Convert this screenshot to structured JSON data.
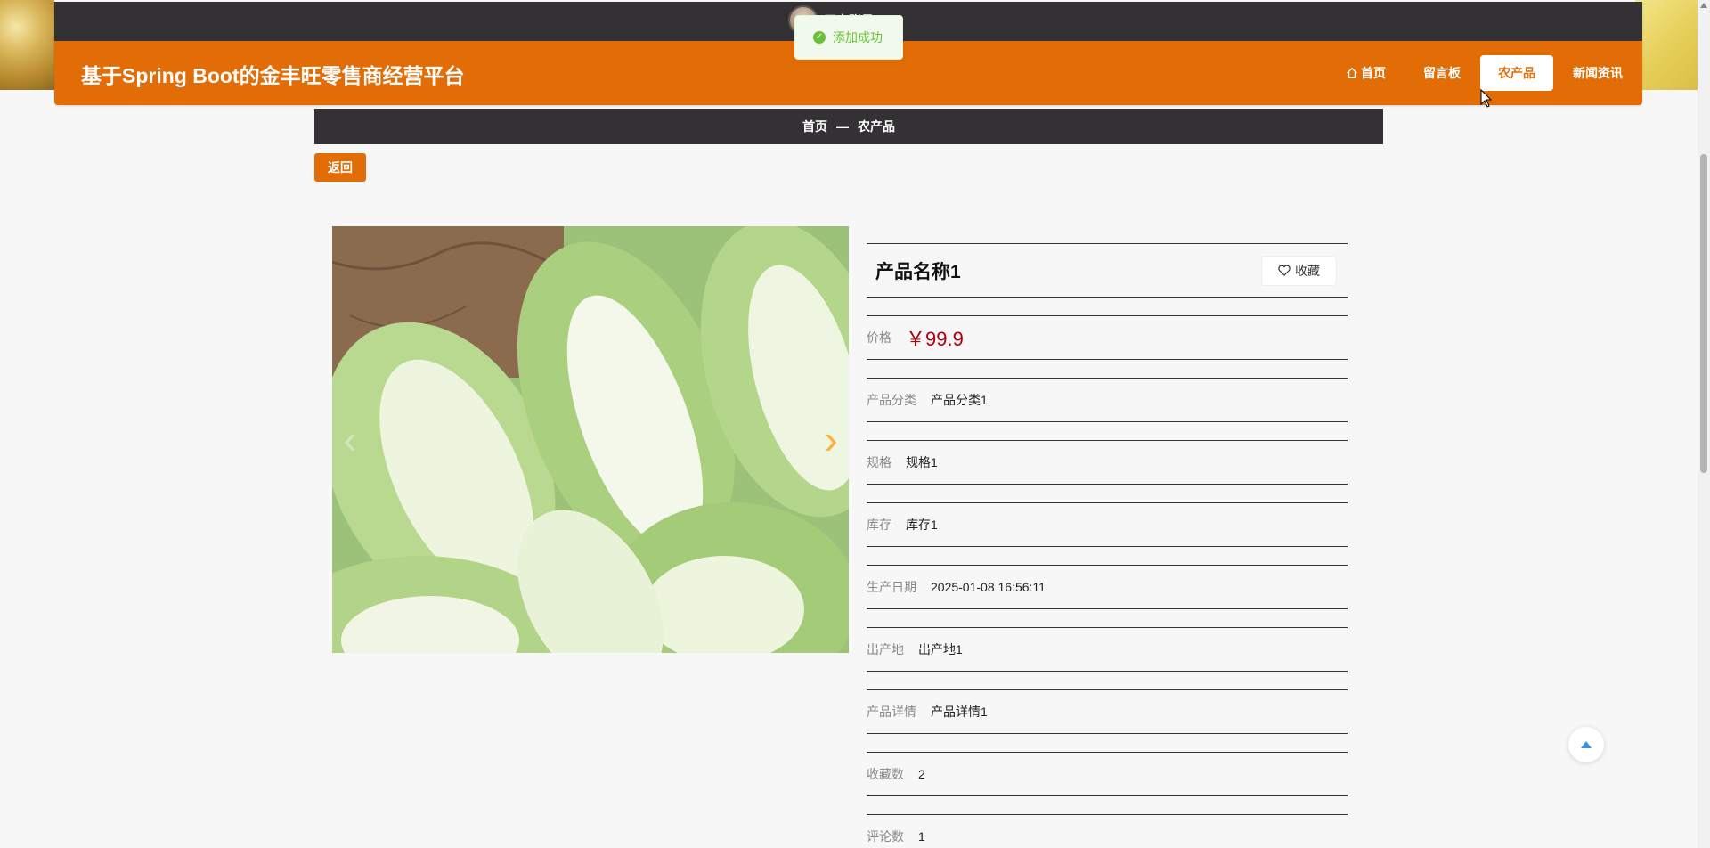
{
  "header": {
    "site_title": "基于Spring Boot的金丰旺零售商经营平台",
    "user_name": "用户账号1",
    "nav": [
      {
        "label": "首页",
        "icon": "home-icon"
      },
      {
        "label": "留言板"
      },
      {
        "label": "农产品",
        "active": true
      },
      {
        "label": "新闻资讯"
      }
    ]
  },
  "toast": {
    "message": "添加成功",
    "icon": "check-circle-icon"
  },
  "breadcrumb": {
    "home": "首页",
    "separator": "—",
    "current": "农产品"
  },
  "back_label": "返回",
  "product": {
    "name": "产品名称1",
    "favorite_label": "收藏",
    "rows": [
      {
        "label": "价格",
        "value": "￥99.9",
        "type": "price"
      },
      {
        "label": "产品分类",
        "value": "产品分类1"
      },
      {
        "label": "规格",
        "value": "规格1"
      },
      {
        "label": "库存",
        "value": "库存1"
      },
      {
        "label": "生产日期",
        "value": "2025-01-08 16:56:11"
      },
      {
        "label": "出产地",
        "value": "出产地1"
      },
      {
        "label": "产品详情",
        "value": "产品详情1"
      },
      {
        "label": "收藏数",
        "value": "2"
      },
      {
        "label": "评论数",
        "value": "1"
      }
    ]
  },
  "carousel": {
    "prev_icon": "chevron-left-icon",
    "next_icon": "chevron-right-icon"
  },
  "colors": {
    "brand": "#e26d06",
    "dark": "#333133",
    "price": "#b0000d",
    "success": "#67c23a"
  }
}
